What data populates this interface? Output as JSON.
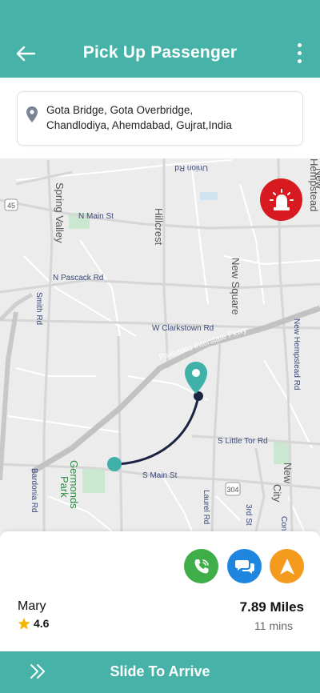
{
  "header": {
    "title": "Pick Up Passenger",
    "back_icon": "arrow-left-icon",
    "menu_icon": "more-vertical-icon",
    "color": "#47b3a8"
  },
  "pickup": {
    "icon": "location-pin-icon",
    "address_line1": "Gota Bridge, Gota Overbridge,",
    "address_line2": "Chandlodiya, Ahemdabad, Gujrat,India"
  },
  "map": {
    "labels": {
      "union": "Union Rd",
      "spring_valley": "Spring Valley",
      "n_main": "N Main St",
      "hillcrest": "Hillcrest",
      "hempstead_top": "Hempstead",
      "new_top": "New",
      "route45": "45",
      "n_pascack": "N Pascack Rd",
      "new_square": "New Square",
      "smith": "Smith Rd",
      "w_clarkstown": "W Clarkstown Rd",
      "palisades": "Palisades Interstate Pkwy",
      "new_hempstead": "New Hempstead Rd",
      "s_little_tor": "S Little Tor Rd",
      "germonds": "Germonds",
      "park": "Park",
      "s_main": "S Main St",
      "bardonia": "Bardonia Rd",
      "route304": "304",
      "laurel": "Laurel Rd",
      "third": "3rd St",
      "new_city_1": "New",
      "new_city_2": "City",
      "con": "Con"
    },
    "alarm_icon": "siren-icon",
    "alarm_color": "#d71920"
  },
  "passenger": {
    "name": "Mary",
    "rating": "4.6",
    "star_icon": "star-icon",
    "distance": "7.89 Miles",
    "eta": "11 mins"
  },
  "actions": {
    "call_icon": "phone-icon",
    "chat_icon": "chat-bubbles-icon",
    "navigate_icon": "navigation-arrow-icon",
    "call_color": "#3fae49",
    "chat_color": "#1f86e0",
    "navigate_color": "#f49a1c"
  },
  "slider": {
    "label": "Slide To Arrive",
    "icon": "double-chevron-right-icon"
  }
}
